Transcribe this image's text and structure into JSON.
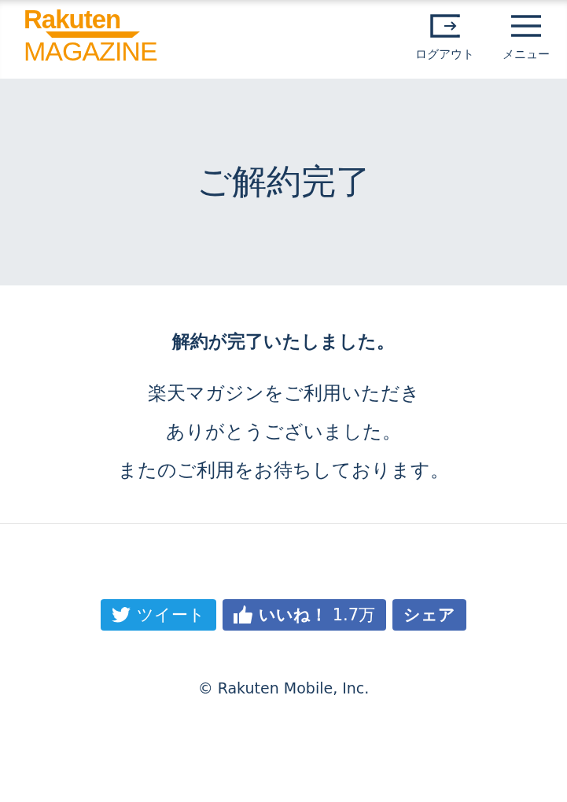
{
  "header": {
    "logo": {
      "brand": "Rakuten",
      "product": "MAGAZINE"
    },
    "actions": [
      {
        "kind": "logout",
        "label": "ログアウト"
      },
      {
        "kind": "menu",
        "label": "メニュー"
      }
    ]
  },
  "hero": {
    "title": "ご解約完了"
  },
  "message": {
    "heading": "解約が完了いたしました。",
    "lines": [
      "楽天マガジンをご利用いただき",
      "ありがとうございました。",
      "またのご利用をお待ちしております。"
    ]
  },
  "share_buttons": [
    {
      "kind": "tweet",
      "label": "ツイート"
    },
    {
      "kind": "like",
      "label": "**いいね！** 1.7万"
    },
    {
      "kind": "share",
      "label": "シェア"
    }
  ],
  "footer": {
    "copyright": "© Rakuten Mobile, Inc."
  }
}
